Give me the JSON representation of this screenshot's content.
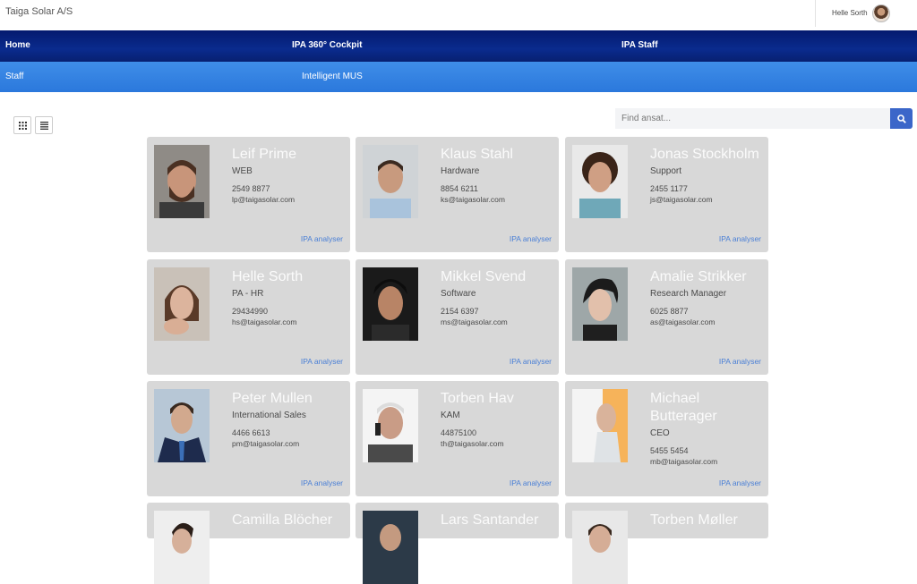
{
  "header": {
    "brand": "Taiga Solar A/S",
    "user_name": "Helle Sorth"
  },
  "nav_primary": [
    "Home",
    "IPA 360° Cockpit",
    "IPA Staff"
  ],
  "nav_secondary": [
    "Staff",
    "Intelligent MUS"
  ],
  "toolbar": {
    "view_grid_icon": "grid-icon",
    "view_list_icon": "list-icon"
  },
  "search": {
    "placeholder": "Find ansat...",
    "icon": "search-icon"
  },
  "employees": [
    {
      "name": "Leif Prime",
      "title": "WEB",
      "phone": "2549 8877",
      "email": "lp@taigasolar.com",
      "link": "IPA analyser"
    },
    {
      "name": "Klaus Stahl",
      "title": "Hardware",
      "phone": "8854 6211",
      "email": "ks@taigasolar.com",
      "link": "IPA analyser"
    },
    {
      "name": "Jonas Stockholm",
      "title": "Support",
      "phone": "2455 1177",
      "email": "js@taigasolar.com",
      "link": "IPA analyser"
    },
    {
      "name": "Helle Sorth",
      "title": "PA - HR",
      "phone": "29434990",
      "email": "hs@taigasolar.com",
      "link": "IPA analyser"
    },
    {
      "name": "Mikkel Svend",
      "title": "Software",
      "phone": "2154 6397",
      "email": "ms@taigasolar.com",
      "link": "IPA analyser"
    },
    {
      "name": "Amalie Strikker",
      "title": "Research Manager",
      "phone": "6025 8877",
      "email": "as@taigasolar.com",
      "link": "IPA analyser"
    },
    {
      "name": "Peter Mullen",
      "title": "International Sales",
      "phone": "4466 6613",
      "email": "pm@taigasolar.com",
      "link": "IPA analyser"
    },
    {
      "name": "Torben Hav",
      "title": "KAM",
      "phone": "44875100",
      "email": "th@taigasolar.com",
      "link": "IPA analyser"
    },
    {
      "name": "Michael Butterager",
      "title": "CEO",
      "phone": "5455 5454",
      "email": "mb@taigasolar.com",
      "link": "IPA analyser"
    },
    {
      "name": "Camilla Blöcher"
    },
    {
      "name": "Lars Santander"
    },
    {
      "name": "Torben Møller"
    }
  ]
}
